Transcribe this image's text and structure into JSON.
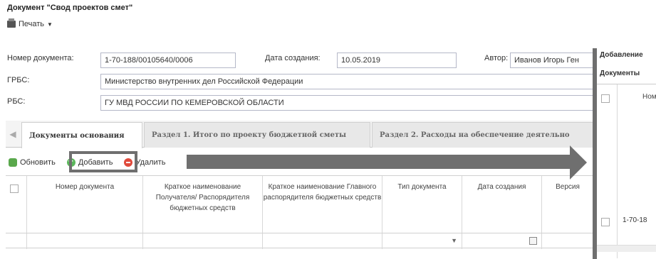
{
  "window": {
    "title": "Документ \"Свод проектов смет\""
  },
  "toolbar": {
    "print_label": "Печать"
  },
  "form": {
    "doc_number_label": "Номер документа:",
    "doc_number_value": "1-70-188/00105640/0006",
    "created_label": "Дата создания:",
    "created_value": "10.05.2019",
    "author_label": "Автор:",
    "author_value": "Иванов Игорь Ген",
    "grbs_label": "ГРБС:",
    "grbs_value": "Министерство внутренних дел Российской Федерации",
    "rbs_label": "РБС:",
    "rbs_value": "ГУ МВД РОССИИ ПО КЕМЕРОВСКОЙ ОБЛАСТИ"
  },
  "tabs": [
    {
      "label": "Документы основания",
      "active": true
    },
    {
      "label": "Раздел 1. Итого по проекту бюджетной сметы",
      "active": false
    },
    {
      "label": "Раздел 2. Расходы на обеспечение деятельно",
      "active": false
    }
  ],
  "actions": {
    "refresh": "Обновить",
    "add": "Добавить",
    "delete": "Удалить"
  },
  "grid": {
    "columns": [
      "Номер документа",
      "Краткое наименование Получателя/ Распорядителя бюджетных средств",
      "Краткое наименование Главного распорядителя бюджетных средств",
      "Тип документа",
      "Дата создания",
      "Версия"
    ]
  },
  "dialog": {
    "title": "Добавление",
    "subtitle": "Документы",
    "column_header": "Ном",
    "row_value": "1-70-18"
  }
}
